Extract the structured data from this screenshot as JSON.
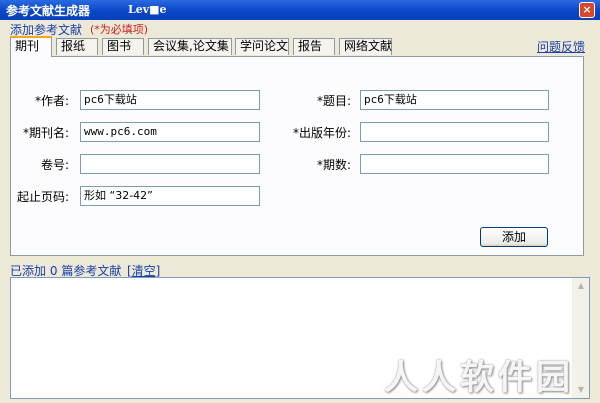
{
  "window": {
    "title": "参考文献生成器",
    "title_suffix": "Lev■e",
    "close_label": "×"
  },
  "header": {
    "add_ref_label": "添加参考文献",
    "required_note": "(*为必填项)",
    "feedback_link": "问题反馈"
  },
  "tabs": [
    {
      "label": "期刊",
      "active": true
    },
    {
      "label": "报纸"
    },
    {
      "label": "图书"
    },
    {
      "label": "会议集,论文集"
    },
    {
      "label": "学问论文"
    },
    {
      "label": "报告"
    },
    {
      "label": "网络文献"
    }
  ],
  "form": {
    "author": {
      "label": "*作者:",
      "value": "pc6下载站"
    },
    "title": {
      "label": "*题目:",
      "value": "pc6下载站"
    },
    "journal": {
      "label": "*期刊名:",
      "value": "www.pc6.com"
    },
    "year": {
      "label": "*出版年份:",
      "value": ""
    },
    "volume": {
      "label": "卷号:",
      "value": ""
    },
    "issue": {
      "label": "*期数:",
      "value": ""
    },
    "pages": {
      "label": "起止页码:",
      "value": "形如 “32-42”"
    },
    "add_button": "添加"
  },
  "status": {
    "prefix": "已添加",
    "count": "0",
    "suffix": "篇参考文献",
    "clear_link": "[清空]"
  },
  "output": {
    "text": ""
  },
  "watermark": "人人软件园"
}
